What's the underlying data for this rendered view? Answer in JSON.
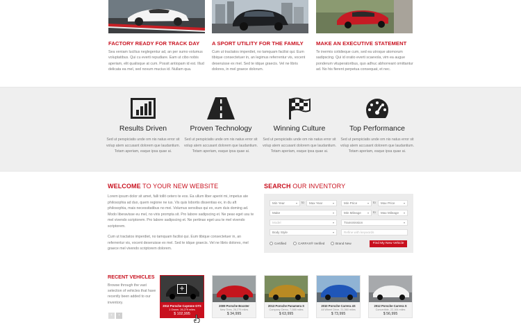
{
  "features": [
    {
      "title": "FACTORY READY FOR TRACK DAY",
      "text": "Sea veniam lucilius neglegentur ad, an per sumo volumus voluptatibus. Qui cu everti repudiare. Eam ut cibo nobis aperiam, elit qualisque at cum. Possit antiopam id est. Illud delicata ea mel, sed novum mucius id. Nullam qua."
    },
    {
      "title": "A SPORT UTILITY FOR THE FAMILY",
      "text": "Cum ut tractatos imperdiet, no tamquam facilisi qui. Eum tibique consectetuer in, an legimus referrentur vis, vocent deseruisse ex mel. Sed te idque graecis. Vel ne libris dolores, in mel graece dolorum."
    },
    {
      "title": "MAKE AN EXECUTIVE STATEMENT",
      "text": "Te inermis cotidieque cum, sed ea utroque atomorum sadipscing. Qui id oratio everti scaevola, vim ea augue ponderum vituperatoribus, quo adhuc abhorreant omittantur ad. No his fierent perpetua consequat, et nec."
    }
  ],
  "stats": [
    {
      "icon": "bar-chart-icon",
      "title": "Results Driven",
      "text": "Sed ut perspiciatis unde om nis natus error sit volup atem accusant dolorem que laudantium. Totam aperiam, eaque ipsa quae ai."
    },
    {
      "icon": "road-icon",
      "title": "Proven Technology",
      "text": "Sed ut perspiciatis unde om nis natus error sit volup atem accusant dolorem que laudantium. Totam aperiam, eaque ipsa quae ai."
    },
    {
      "icon": "checkered-flag-icon",
      "title": "Winning Culture",
      "text": "Sed ut perspiciatis unde om nis natus error sit volup atem accusant dolorem que laudantium. Totam aperiam, eaque ipsa quae ai."
    },
    {
      "icon": "speedometer-icon",
      "title": "Top Performance",
      "text": "Sed ut perspiciatis unde om nis natus error sit volup atem accusant dolorem que laudantium. Totam aperiam, eaque ipsa quae ai."
    }
  ],
  "welcome": {
    "title_bold": "WELCOME",
    "title_rest": " TO YOUR NEW WEBSITE",
    "para1": "Lorem ipsum dolor sit amet, falli tollit cetero te eos. Ea ullum liber aperiri mi, impetus ate philosophia ad duo, quem regione ne ius. Vis quis lobortis dissentias ex, in du aft philosophia, mais necessitatibus no mei. Volumus sensibus qui ex, eum duis doming ad. Modo liberavisse eu mel, no viris prompta sit. Pro labore sadipscing et. Ne peax eget usu te mel vivendo scriptorem. Pro labore sadipscing et. Ne pertinax eget usu te mel vivendo scriptorem.",
    "para2": "Cum ut tractatos imperdiet, no tamquam facilisi qui. Eum tibique consectetuer in, an referrentur vis, vocent deseruisse ex mel. Sed te idque graecis. Vel ne libris dolores, mel graece mel vivendo scriptorem dolorem."
  },
  "search": {
    "title_bold": "SEARCH",
    "title_rest": " OUR INVENTORY",
    "min_year": "Min Year",
    "max_year": "Max Year",
    "min_price": "Min Price",
    "max_price": "Max Price",
    "make": "Make",
    "min_mileage": "Min Mileage",
    "max_mileage": "Max Mileage",
    "model": "Model",
    "transmission": "Transmission",
    "body_style": "Body Style",
    "keywords": "Refine with keywords",
    "to": "to",
    "certified": "Certified",
    "carfax": "CARFAX® Verified",
    "brand_new": "Brand New",
    "button": "Find My New Vehicle"
  },
  "recent": {
    "title": "RECENT VEHICLES",
    "text": "Browse through the vast selection of vehicles that have recently been added to our inventory.",
    "prev": "‹",
    "next": "›"
  },
  "vehicles": [
    {
      "name": "2012 Porsche Cayenne GTS",
      "meta": "1 Owner, 26,279 miles",
      "price": "$ 102,995"
    },
    {
      "name": "2009 Porsche Boxster",
      "meta": "New Tires, 26,279 miles",
      "price": "$ 34,995"
    },
    {
      "name": "2013 Porsche Panamera S",
      "meta": "Company Demo, 7,088 miles",
      "price": "$ 63,995"
    },
    {
      "name": "2010 Porsche Carrera 4S",
      "meta": "All Wheel Drive, 21,360 miles",
      "price": "$ 73,995"
    },
    {
      "name": "2012 Porsche Carrera S",
      "meta": "Convertible, 22,164 miles",
      "price": "$ 56,995"
    }
  ],
  "colors": {
    "accent": "#c8101e",
    "band": "#efefef"
  }
}
